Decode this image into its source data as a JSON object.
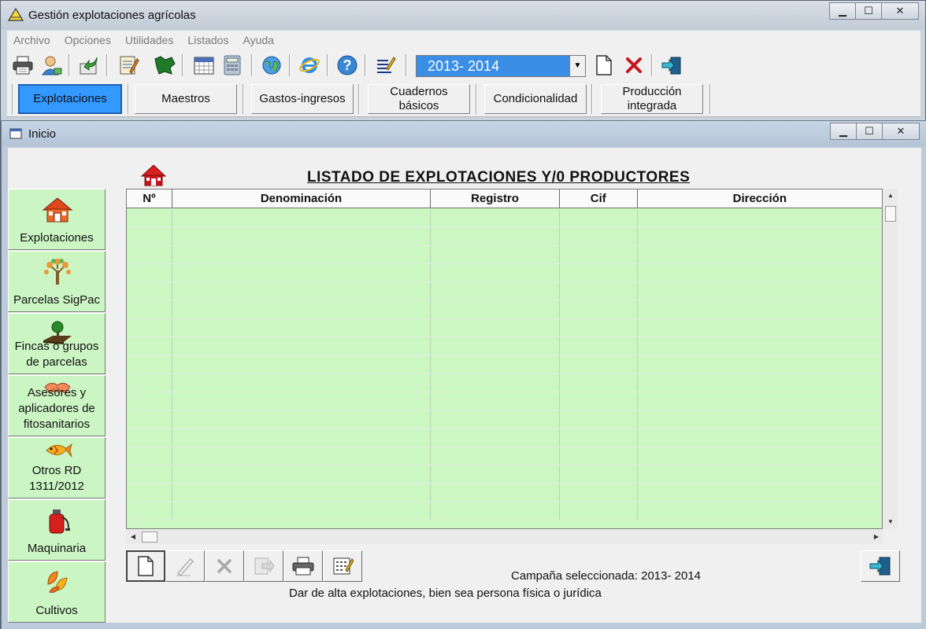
{
  "window": {
    "title": "Gestión explotaciones agrícolas",
    "minimize": "▁",
    "maximize": "☐",
    "close": "✕"
  },
  "menu": [
    "Archivo",
    "Opciones",
    "Utilidades",
    "Listados",
    "Ayuda"
  ],
  "toolbar": {
    "icons": [
      "printer-icon",
      "user-icon",
      "share-icon",
      "notepad-icon",
      "map-icon",
      "calendar-icon",
      "calculator-icon",
      "globe-icon",
      "internet-explorer-icon",
      "help-icon",
      "edit-list-icon"
    ],
    "campaign_value": "2013- 2014",
    "dropdown_arrow": "▼",
    "new_doc_icon": "new-document-icon",
    "delete_icon": "delete-x-icon",
    "exit_icon": "exit-door-icon"
  },
  "tabs": [
    {
      "label": "Explotaciones",
      "active": true
    },
    {
      "label": "Maestros",
      "active": false
    },
    {
      "label": "Gastos-ingresos",
      "active": false
    },
    {
      "label": "Cuadernos básicos",
      "active": false
    },
    {
      "label": "Condicionalidad",
      "active": false
    },
    {
      "label": "Producción integrada",
      "active": false
    }
  ],
  "child_window": {
    "title": "Inicio"
  },
  "list_title": "LISTADO DE EXPLOTACIONES Y/0 PRODUCTORES",
  "leftnav": [
    {
      "label": "Explotaciones",
      "icon": "farmhouse-icon"
    },
    {
      "label": "Parcelas SigPac",
      "icon": "tree-icon"
    },
    {
      "label": "Fincas o grupos de parcelas",
      "icon": "plant-soil-icon"
    },
    {
      "label": "Asesores y aplicadores de fitosanitarios",
      "icon": "handshake-icon"
    },
    {
      "label": "Otros RD 1311/2012",
      "icon": "fish-icon"
    },
    {
      "label": "Maquinaria",
      "icon": "sprayer-icon"
    },
    {
      "label": "Cultivos",
      "icon": "leaves-icon"
    }
  ],
  "grid": {
    "columns": [
      "Nº",
      "Denominación",
      "Registro",
      "Cif",
      "Dirección"
    ],
    "row_count": 17
  },
  "actions": [
    "new-record-icon",
    "edit-pencil-icon",
    "delete-icon",
    "export-icon",
    "print-icon",
    "list-edit-icon"
  ],
  "status": {
    "campaign_label": "Campaña seleccionada:  2013- 2014",
    "hint": "Dar de alta explotaciones, bien sea persona física o jurídica"
  },
  "colors": {
    "grid_bg": "#ccf7c2",
    "nav_bg": "#ccf5c4",
    "active_tab": "#3399ff",
    "campaign_select": "#3a8ee6"
  }
}
